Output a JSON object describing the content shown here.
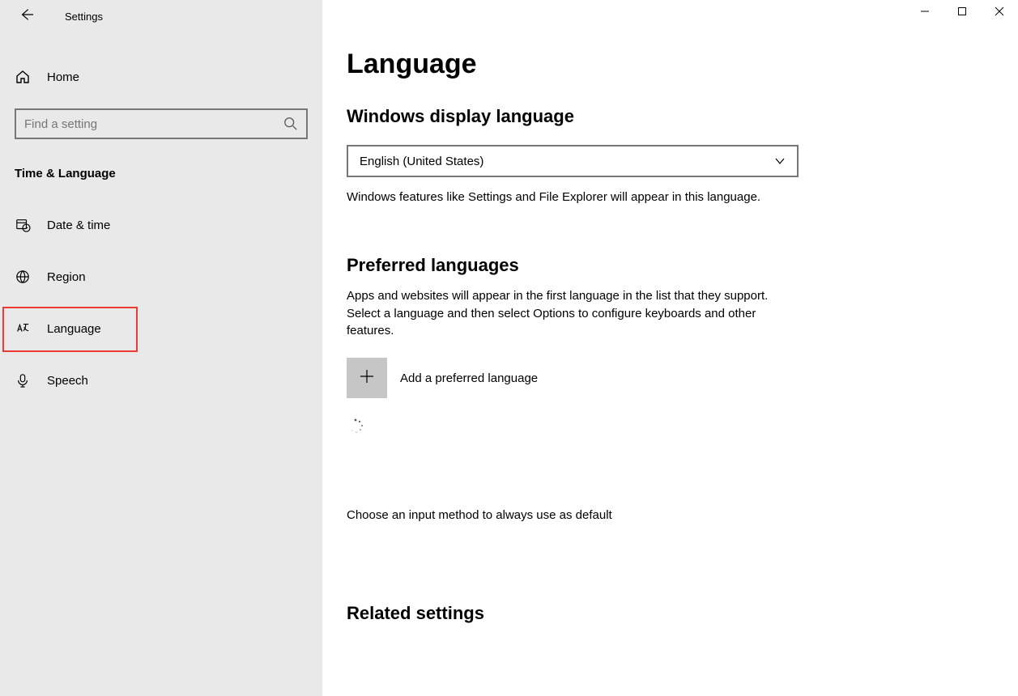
{
  "window": {
    "title": "Settings"
  },
  "sidebar": {
    "home": "Home",
    "search_placeholder": "Find a setting",
    "category": "Time & Language",
    "items": [
      {
        "label": "Date & time"
      },
      {
        "label": "Region"
      },
      {
        "label": "Language"
      },
      {
        "label": "Speech"
      }
    ]
  },
  "main": {
    "page_title": "Language",
    "display_lang": {
      "heading": "Windows display language",
      "selected": "English (United States)",
      "desc": "Windows features like Settings and File Explorer will appear in this language."
    },
    "preferred": {
      "heading": "Preferred languages",
      "desc": "Apps and websites will appear in the first language in the list that they support. Select a language and then select Options to configure keyboards and other features.",
      "add_label": "Add a preferred language"
    },
    "input_method_link": "Choose an input method to always use as default",
    "related_heading": "Related settings"
  }
}
